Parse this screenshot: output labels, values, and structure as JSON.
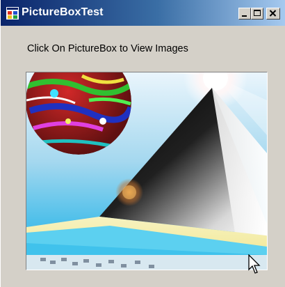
{
  "window": {
    "title": "PictureBoxTest"
  },
  "content": {
    "instruction_label": "Click On PictureBox to View Images"
  },
  "icons": {
    "app": "app-form-icon",
    "minimize": "minimize-icon",
    "maximize": "maximize-icon",
    "close": "close-icon",
    "cursor": "mouse-pointer-icon"
  },
  "colors": {
    "titlebar_start": "#0a246a",
    "titlebar_end": "#a6caf0",
    "window_face": "#d4d0c8"
  }
}
